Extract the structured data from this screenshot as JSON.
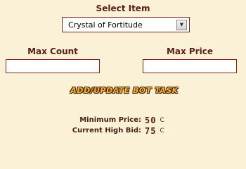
{
  "select": {
    "heading": "Select Item",
    "selected": "Crystal of Fortitude",
    "arrow_icon": "chevron-down-icon"
  },
  "count": {
    "heading": "Max Count",
    "value": ""
  },
  "price": {
    "heading": "Max Price",
    "value": ""
  },
  "action": {
    "label": "ADD/UPDATE BOT TASK"
  },
  "stats": {
    "min_price_label": "Minimum Price:",
    "min_price_value": "50",
    "min_price_unit": "C",
    "high_bid_label": "Current High Bid:",
    "high_bid_value": "75",
    "high_bid_unit": "C"
  },
  "colors": {
    "background": "#fbf1d7",
    "text": "#5c1d16",
    "border": "#7a2a22",
    "button_fill": "#f4b534"
  }
}
